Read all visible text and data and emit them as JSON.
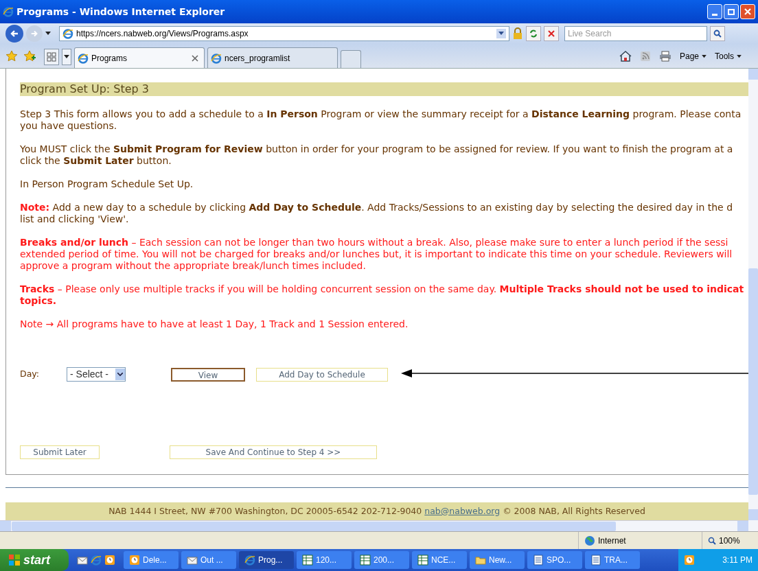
{
  "window": {
    "title": "Programs - Windows Internet Explorer"
  },
  "address_bar": {
    "url": "https://ncers.nabweb.org/Views/Programs.aspx",
    "search_placeholder": "Live Search"
  },
  "tabs": [
    {
      "label": "Programs",
      "selected": true
    },
    {
      "label": "ncers_programlist",
      "selected": false
    }
  ],
  "commands": [
    "Page",
    "Tools"
  ],
  "page": {
    "heading": "Program Set Up: Step 3",
    "paragraphs": [
      {
        "kind": "plain",
        "lines": [
          "Step 3 This form allows you to add a schedule to a **In Person** Program or view the summary receipt for a **Distance Learning** program. Please conta",
          "you have questions."
        ]
      },
      {
        "kind": "plain",
        "lines": [
          "You MUST click the **Submit Program for Review** button in order for your program to be assigned for review. If you want to finish the program at a",
          "click the **Submit Later** button."
        ]
      },
      {
        "kind": "plain",
        "lines": [
          "In Person Program Schedule Set Up."
        ]
      },
      {
        "kind": "note",
        "label": "Note:",
        "lines": [
          " Add a new day to a schedule by clicking **Add Day to Schedule**. Add Tracks/Sessions to an existing day by selecting the desired day in the d",
          "list and clicking 'View'."
        ]
      },
      {
        "kind": "alert",
        "label": "Breaks and/or lunch",
        "lines": [
          " – Each session can not be longer than two hours without a break. Also, please make sure to enter a lunch period if the sessi",
          "extended period of time. You will not be charged for breaks and/or lunches but, it is important to indicate this time on your schedule. Reviewers will",
          "approve a program without the appropriate break/lunch times included."
        ]
      },
      {
        "kind": "alert",
        "label": "Tracks",
        "lines": [
          " – Please only use multiple tracks if you will be holding concurrent session on the same day. **Multiple Tracks should not be used to indicat**",
          "**topics.**"
        ]
      },
      {
        "kind": "alert",
        "lines": [
          "Note → All programs have to have at least 1 Day, 1 Track and 1 Session entered."
        ]
      }
    ],
    "day_label": "Day:",
    "day_select": "- Select -",
    "buttons": [
      {
        "label": "View",
        "focused": true
      },
      {
        "label": "Add Day to Schedule",
        "focused": false
      }
    ],
    "bottom_buttons": [
      "Submit Later",
      "Save And Continue to Step 4 >>"
    ],
    "footer": {
      "text": "NAB 1444 I Street, NW #700 Washington, DC 20005-6542 202-712-9040",
      "email": "nab@nabweb.org",
      "rights": "© 2008 NAB, All Rights Reserved"
    }
  },
  "status_bar": {
    "zone": "Internet",
    "zoom": "100%"
  },
  "taskbar": {
    "start": "start",
    "items": [
      {
        "label": "Dele...",
        "kind": "clock",
        "selected": false
      },
      {
        "label": "Out ...",
        "kind": "mail",
        "selected": false
      },
      {
        "label": "Prog...",
        "kind": "browser",
        "selected": true
      },
      {
        "label": "120...",
        "kind": "sheet",
        "selected": false
      },
      {
        "label": "200...",
        "kind": "sheet",
        "selected": false
      },
      {
        "label": "NCE...",
        "kind": "sheet",
        "selected": false
      },
      {
        "label": "New...",
        "kind": "folder",
        "selected": false
      },
      {
        "label": "SPO...",
        "kind": "doc",
        "selected": false
      },
      {
        "label": "TRA...",
        "kind": "doc",
        "selected": false
      }
    ],
    "clock": "3:11 PM"
  }
}
